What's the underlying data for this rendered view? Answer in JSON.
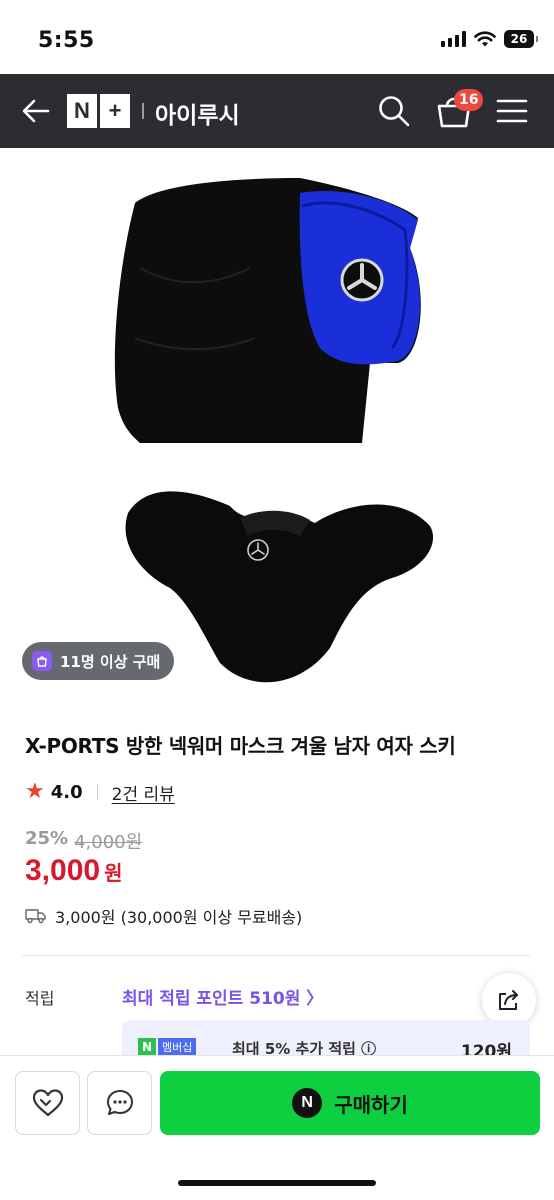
{
  "status_bar": {
    "time": "5:55",
    "battery": "26"
  },
  "header": {
    "logo_n": "N",
    "logo_plus": "+",
    "store_name": "아이루시",
    "cart_count": "16"
  },
  "product": {
    "buyer_badge": "11명 이상 구매",
    "title": "X-PORTS 방한 넥워머 마스크 겨울 남자 여자 스키",
    "rating": "4.0",
    "review_link": "2건 리뷰",
    "discount": "25%",
    "original_price": "4,000원",
    "price": "3,000",
    "price_unit": "원",
    "shipping": "3,000원 (30,000원 이상 무료배송)"
  },
  "points": {
    "label": "적립",
    "max_points_link": "최대 적립 포인트 510원 〉",
    "membership_chip_n": "N",
    "membership_chip_text": "멤버십",
    "membership_text": "최대 5% 추가 적립 ⓘ",
    "membership_amount": "120원"
  },
  "bottom_bar": {
    "buy_n": "N",
    "buy_label": "구매하기"
  }
}
